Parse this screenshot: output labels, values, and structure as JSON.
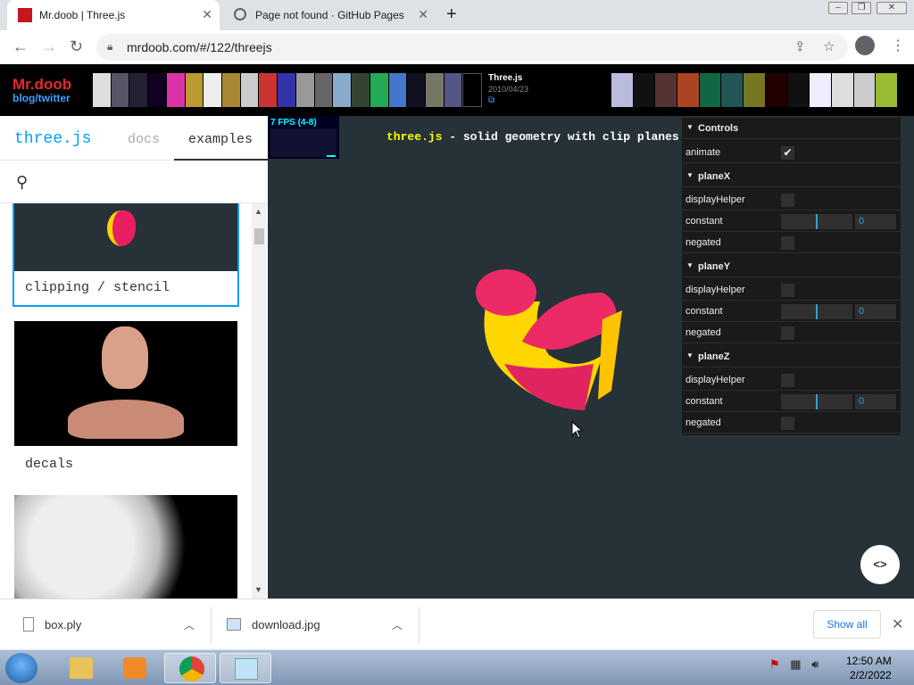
{
  "browser": {
    "tabs": [
      {
        "title": "Mr.doob | Three.js",
        "active": true
      },
      {
        "title": "Page not found · GitHub Pages",
        "active": false
      }
    ],
    "url": "mrdoob.com/#/122/threejs"
  },
  "banner": {
    "logo_line1": "Mr.doob",
    "logo_line2": "blog/twitter",
    "project_title": "Three.js",
    "project_date": "2010/04/23",
    "project_link_icon": "external-link-icon"
  },
  "sidebar": {
    "title": "three.js",
    "tabs": [
      {
        "label": "docs"
      },
      {
        "label": "examples"
      }
    ],
    "examples": [
      {
        "label": "clipping / stencil",
        "selected": true
      },
      {
        "label": "decals",
        "selected": false
      },
      {
        "label": "",
        "selected": false
      }
    ]
  },
  "viewport": {
    "fps": "7 FPS (4-8)",
    "info_link": "three.js",
    "info_text": " - solid geometry with clip planes and"
  },
  "gui": {
    "root": "Controls",
    "animate_label": "animate",
    "animate_checked": true,
    "folders": [
      {
        "name": "planeX",
        "display_helper": "displayHelper",
        "constant": "constant",
        "negated": "negated",
        "value": "0",
        "fill": 0.5
      },
      {
        "name": "planeY",
        "display_helper": "displayHelper",
        "constant": "constant",
        "negated": "negated",
        "value": "0",
        "fill": 0.5
      },
      {
        "name": "planeZ",
        "display_helper": "displayHelper",
        "constant": "constant",
        "negated": "negated",
        "value": "0",
        "fill": 0.5
      }
    ]
  },
  "code_button": "<>",
  "downloads": {
    "items": [
      {
        "name": "box.ply"
      },
      {
        "name": "download.jpg"
      }
    ],
    "show_all": "Show all"
  },
  "taskbar": {
    "time": "12:50 AM",
    "date": "2/2/2022"
  }
}
